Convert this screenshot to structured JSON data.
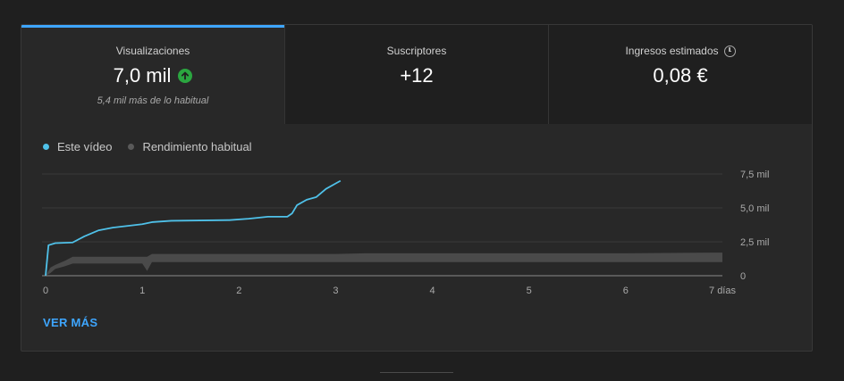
{
  "tabs": [
    {
      "label": "Visualizaciones",
      "value": "7,0 mil",
      "sub": "5,4 mil más de lo habitual",
      "active": true
    },
    {
      "label": "Suscriptores",
      "value": "+12"
    },
    {
      "label": "Ingresos estimados",
      "value": "0,08 €"
    }
  ],
  "colors": {
    "accent": "#3ea6ff",
    "this_video": "#4fc1e9",
    "typical": "#5a5a5a",
    "up": "#2ba640"
  },
  "legend": {
    "this_video": "Este vídeo",
    "typical": "Rendimiento habitual"
  },
  "chart_data": {
    "type": "line",
    "x_unit": "días",
    "xlim": [
      0,
      7
    ],
    "ylim": [
      0,
      7500
    ],
    "x_ticks": [
      "0",
      "1",
      "2",
      "3",
      "4",
      "5",
      "6",
      "7 días"
    ],
    "y_ticks": [
      "7,5 mil",
      "5,0 mil",
      "2,5 mil",
      "0"
    ],
    "series": [
      {
        "name": "Este vídeo",
        "x": [
          0,
          0.03,
          0.1,
          0.28,
          0.4,
          0.55,
          0.7,
          1.0,
          1.1,
          1.3,
          1.9,
          2.1,
          2.3,
          2.5,
          2.55,
          2.6,
          2.7,
          2.8,
          2.9,
          3.0,
          3.05
        ],
        "y": [
          0,
          2250,
          2400,
          2450,
          2900,
          3350,
          3550,
          3800,
          3950,
          4050,
          4100,
          4200,
          4350,
          4350,
          4600,
          5200,
          5600,
          5800,
          6400,
          6800,
          7000
        ]
      },
      {
        "name": "Rendimiento habitual",
        "type": "band",
        "x": [
          0,
          0.05,
          0.1,
          0.2,
          0.28,
          1.0,
          1.05,
          1.1,
          2.0,
          3.0,
          3.3,
          5.0,
          6.0,
          6.9,
          7.0
        ],
        "low": [
          0,
          200,
          500,
          700,
          900,
          900,
          350,
          1000,
          1000,
          1000,
          1000,
          1000,
          1000,
          1000,
          1000
        ],
        "high": [
          0,
          600,
          800,
          1100,
          1400,
          1400,
          1400,
          1600,
          1600,
          1600,
          1650,
          1650,
          1650,
          1700,
          1700
        ]
      }
    ]
  },
  "ver_mas": "VER MÁS"
}
